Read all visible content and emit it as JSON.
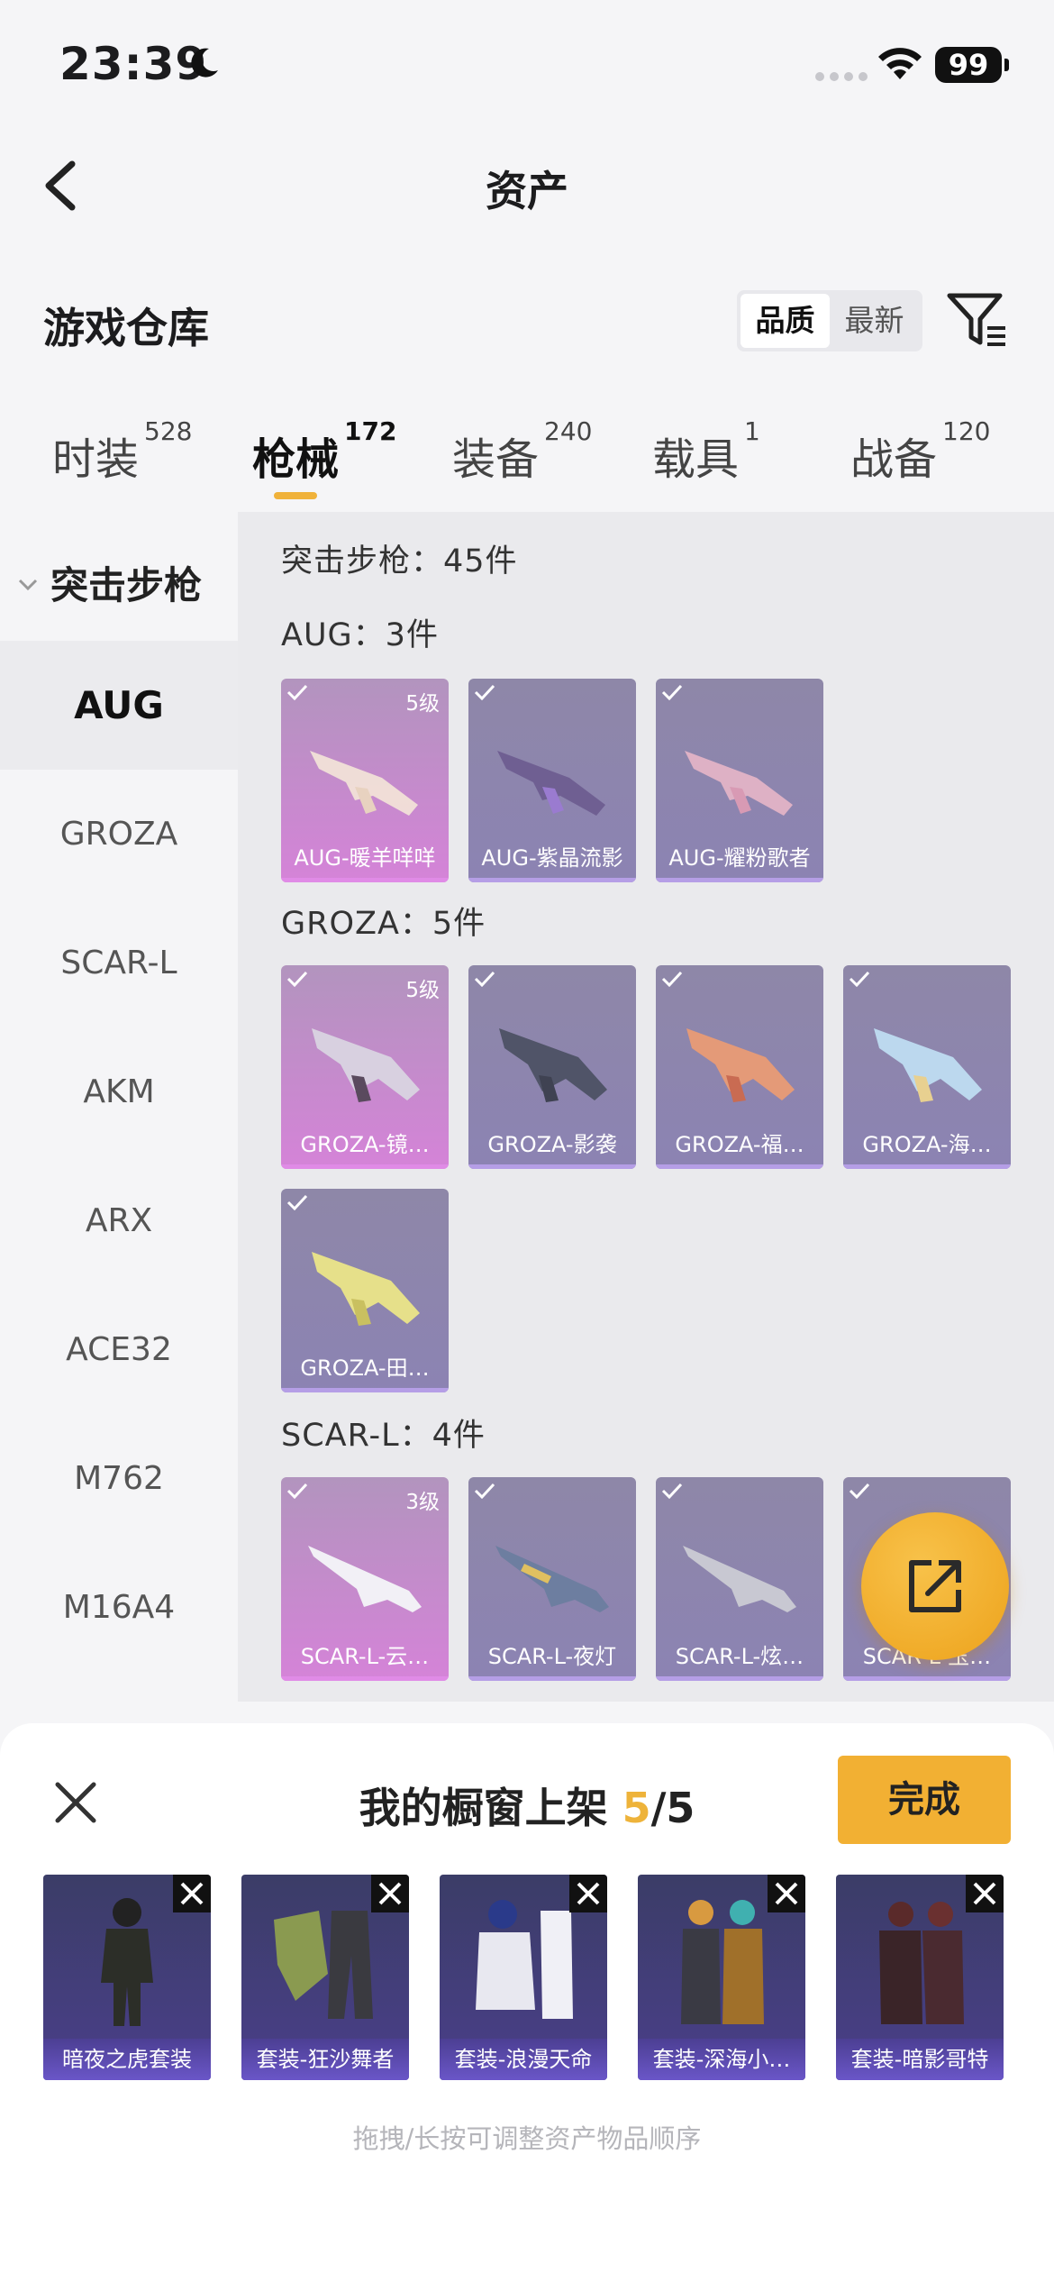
{
  "status": {
    "time": "23:39",
    "battery": "99"
  },
  "nav": {
    "title": "资产"
  },
  "warehouse": {
    "title": "游戏仓库",
    "sort_options": [
      "品质",
      "最新"
    ]
  },
  "tabs": [
    {
      "label": "时装",
      "count": "528"
    },
    {
      "label": "枪械",
      "count": "172"
    },
    {
      "label": "装备",
      "count": "240"
    },
    {
      "label": "载具",
      "count": "1"
    },
    {
      "label": "战备",
      "count": "120"
    }
  ],
  "category": {
    "header": "突击步枪",
    "items": [
      "AUG",
      "GROZA",
      "SCAR-L",
      "AKM",
      "ARX",
      "ACE32",
      "M762",
      "M16A4"
    ]
  },
  "main": {
    "summary": "突击步枪：45件",
    "groups": [
      {
        "title": "AUG：3件",
        "cards": [
          {
            "name": "AUG-暖羊咩咩",
            "level": "5级"
          },
          {
            "name": "AUG-紫晶流影",
            "level": ""
          },
          {
            "name": "AUG-耀粉歌者",
            "level": ""
          }
        ]
      },
      {
        "title": "GROZA：5件",
        "cards": [
          {
            "name": "GROZA-镜…",
            "level": "5级"
          },
          {
            "name": "GROZA-影袭",
            "level": ""
          },
          {
            "name": "GROZA-福…",
            "level": ""
          },
          {
            "name": "GROZA-海…",
            "level": ""
          },
          {
            "name": "GROZA-田…",
            "level": ""
          }
        ]
      },
      {
        "title": "SCAR-L：4件",
        "cards": [
          {
            "name": "SCAR-L-云…",
            "level": "3级"
          },
          {
            "name": "SCAR-L-夜灯",
            "level": ""
          },
          {
            "name": "SCAR-L-炫…",
            "level": ""
          },
          {
            "name": "SCAR-L-玉…",
            "level": ""
          }
        ]
      }
    ]
  },
  "sheet": {
    "title_prefix": "我的橱窗上架",
    "current": "5",
    "total": "/5",
    "done_label": "完成",
    "items": [
      "暗夜之虎套装",
      "套装-狂沙舞者",
      "套装-浪漫天命",
      "套装-深海小…",
      "套装-暗影哥特"
    ],
    "hint": "拖拽/长按可调整资产物品顺序"
  },
  "colors": {
    "accent": "#f2b033",
    "rare_purple": "#8c83b3",
    "legend_pink": "#d583d8"
  }
}
